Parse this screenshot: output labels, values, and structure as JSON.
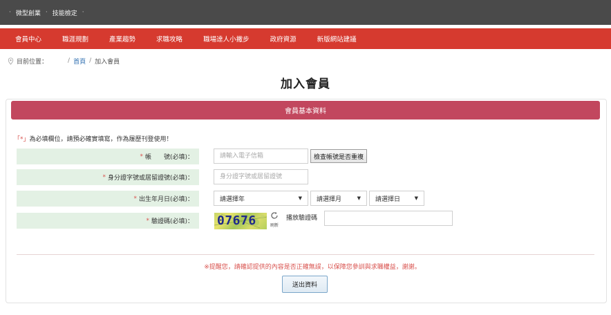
{
  "topbar": {
    "items": [
      "微型創業",
      "技能檢定"
    ]
  },
  "nav": {
    "items": [
      "會員中心",
      "職涯規劃",
      "產業趨勢",
      "求職攻略",
      "職場達人小撇步",
      "政府資源",
      "新版網站建議"
    ]
  },
  "breadcrumb": {
    "label": "目前位置：",
    "home": "首頁",
    "current": "加入會員"
  },
  "page_title": "加入會員",
  "panel": {
    "header": "會員基本資料"
  },
  "notice": {
    "mark": "「*」",
    "text": "為必填欄位，請預必確實填寫，作為履歷刊登使用！"
  },
  "form": {
    "account": {
      "req": "*",
      "label": "帳　　號(必填)：",
      "placeholder": "請輸入電子信箱",
      "check_button": "檢查帳號是否重複"
    },
    "id_number": {
      "req": "*",
      "label": "身分證字號或居留證號(必填)：",
      "placeholder": "身分證字號或居留證號"
    },
    "birthday": {
      "req": "*",
      "label": "出生年月日(必填)：",
      "year": "請選擇年",
      "month": "請選擇月",
      "day": "請選擇日"
    },
    "captcha": {
      "req": "*",
      "label": "驗證碼(必填)：",
      "code": "07676",
      "refresh_label": "刷新",
      "play_audio": "播放驗證碼"
    }
  },
  "reminder": "※提醒您，請確認提供的內容是否正確無誤，以保障您參訓與求職權益，謝謝。",
  "submit_label": "送出資料",
  "colors": {
    "topbar": "#4a4a4a",
    "nav": "#d63a2f",
    "panel_header": "#c2475e",
    "row_label_bg": "#e3f1e4",
    "required": "#d9534f"
  }
}
